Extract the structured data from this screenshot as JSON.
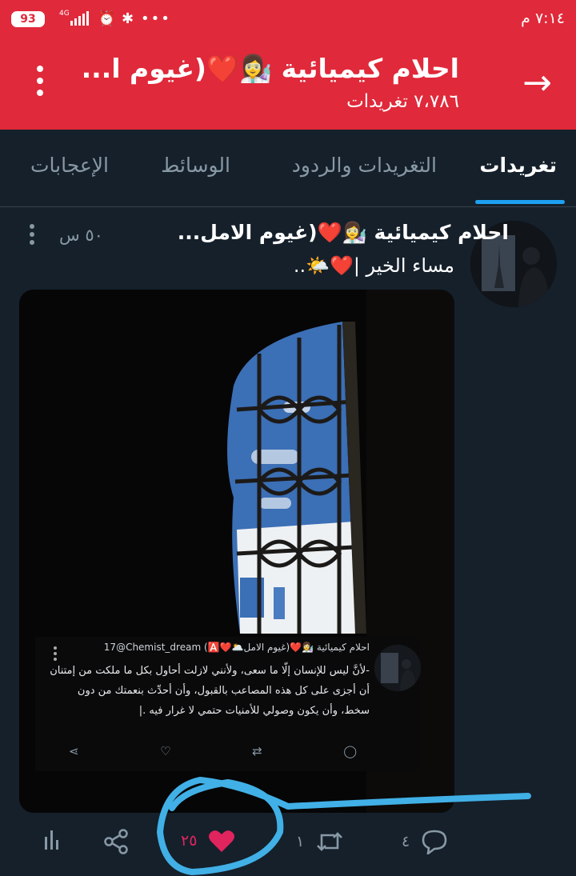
{
  "status_bar": {
    "battery": "93",
    "network": "4G",
    "time": "٧:١٤ م"
  },
  "header": {
    "title": "احلام كيميائية 👩‍🔬❤️(غيوم ا...",
    "subtitle": "٧،٧٨٦ تغريدات",
    "back_icon": "arrow-right-icon",
    "more_icon": "vertical-dots-icon"
  },
  "tabs": [
    {
      "label": "تغريدات",
      "active": true
    },
    {
      "label": "التغريدات والردود",
      "active": false
    },
    {
      "label": "الوسائط",
      "active": false
    },
    {
      "label": "الإعجابات",
      "active": false
    }
  ],
  "tweet": {
    "author": "احلام كيميائية 👩‍🔬❤️(غيوم الامل...",
    "time": "٥٠ س",
    "text": "مساء الخير |❤️🌤️..",
    "embedded": {
      "name_line": "احلام كيميائية 👩‍🔬❤️(غيوم الامل🌥️❤️🅰️) 17@Chemist_dream",
      "body": "-لأنَّ ليس للإنسان إلّا ما سعى، ولأنني لازلت أحاول بكل ما ملكت من إمتنان أن أجزى على كل هذه المصاعب بالقبول، وأن أحدِّث بنعمتك من دون سخط، وأن يكون وصولي للأمنيات حتمي لا غرار فيه .|"
    },
    "actions": {
      "replies": "٤",
      "retweets": "١",
      "likes": "٢٥"
    }
  },
  "colors": {
    "header_bg": "#e0293a",
    "app_bg": "#15202b",
    "accent": "#1da1f2",
    "like": "#e0245e",
    "muted": "#8899a6",
    "annotation": "#41b0e6"
  }
}
